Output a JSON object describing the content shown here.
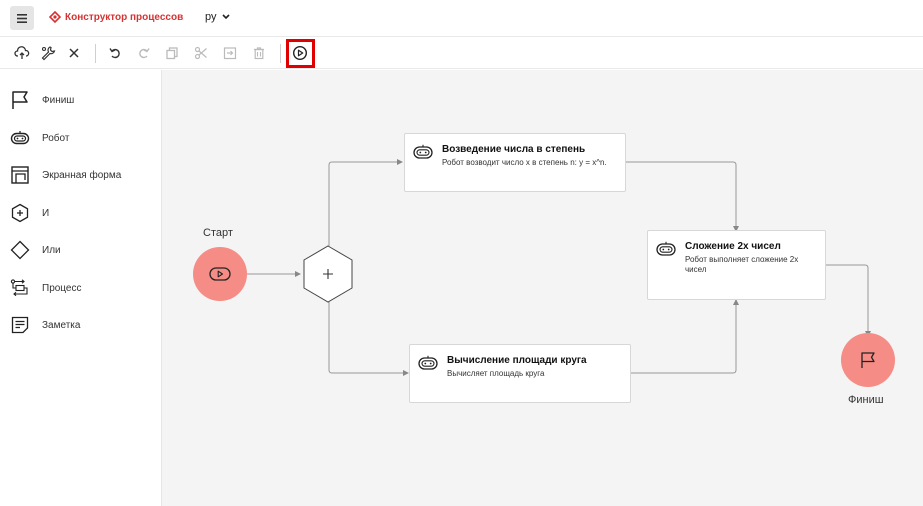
{
  "header": {
    "menu_icon": "hamburger-icon",
    "brand": "Конструктор процессов",
    "language": "ру"
  },
  "toolbar": {
    "buttons": [
      "save-cloud-icon",
      "settings-wrench-icon",
      "close-icon",
      "undo-icon",
      "redo-icon",
      "copy-icon",
      "cut-icon",
      "paste-icon",
      "delete-icon",
      "run-icon"
    ],
    "highlight_color": "#e10000"
  },
  "palette": {
    "items": [
      {
        "label": "Финиш",
        "icon": "flag-icon"
      },
      {
        "label": "Робот",
        "icon": "robot-icon"
      },
      {
        "label": "Экранная форма",
        "icon": "screen-form-icon"
      },
      {
        "label": "И",
        "icon": "and-gateway-icon"
      },
      {
        "label": "Или",
        "icon": "or-gateway-icon"
      },
      {
        "label": "Процесс",
        "icon": "process-icon"
      },
      {
        "label": "Заметка",
        "icon": "note-icon"
      }
    ]
  },
  "diagram": {
    "start_label": "Старт",
    "finish_label": "Финиш",
    "event_color": "#f58c85",
    "tasks": [
      {
        "title": "Возведение числа в степень",
        "desc": "Робот возводит число x в степень n: y = x^n."
      },
      {
        "title": "Сложение 2х чисел",
        "desc": "Робот выполняет сложение 2х чисел"
      },
      {
        "title": "Вычисление площади круга",
        "desc": "Вычисляет площадь круга"
      }
    ]
  }
}
